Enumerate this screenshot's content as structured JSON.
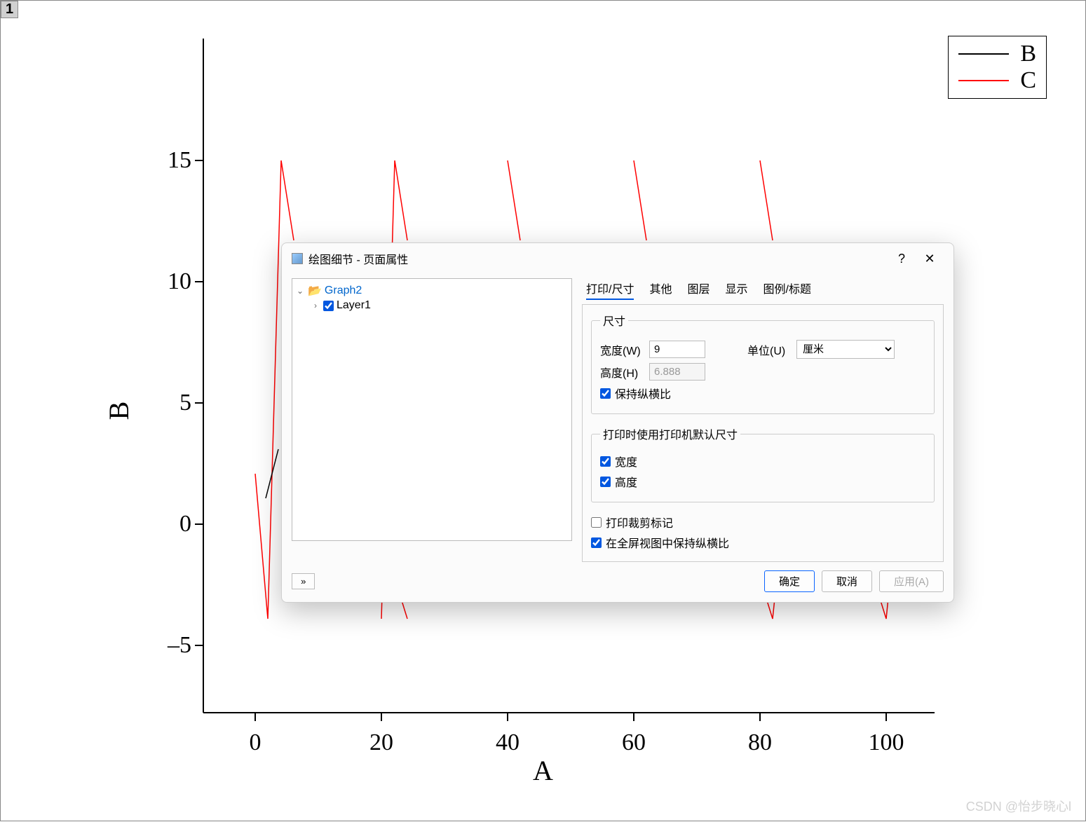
{
  "layer_badge": "1",
  "chart_data": {
    "type": "line",
    "title": "",
    "xlabel": "A",
    "ylabel": "B",
    "x_ticks": [
      0,
      20,
      40,
      60,
      80,
      100
    ],
    "y_ticks": [
      -5,
      0,
      5,
      10,
      15
    ],
    "xlim": [
      -5,
      105
    ],
    "ylim": [
      -8,
      17
    ],
    "legend_position": "top-right",
    "series": [
      {
        "name": "B",
        "color": "#000000",
        "style": "line",
        "values_sample": [
          2,
          4
        ]
      },
      {
        "name": "C",
        "color": "#ff0000",
        "style": "line-sawtooth",
        "period_x": 20,
        "amplitude_high": 15,
        "amplitude_low": -4
      }
    ]
  },
  "legend": {
    "b": "B",
    "c": "C"
  },
  "dialog": {
    "title": "绘图细节 - 页面属性",
    "tree": {
      "graph": "Graph2",
      "layer": "Layer1"
    },
    "tabs": {
      "print_size": "打印/尺寸",
      "other": "其他",
      "layers": "图层",
      "display": "显示",
      "legend_title": "图例/标题"
    },
    "size_group": {
      "legend": "尺寸",
      "width_label": "宽度(W)",
      "width_value": "9",
      "height_label": "高度(H)",
      "height_value": "6.888",
      "unit_label": "单位(U)",
      "unit_value": "厘米",
      "keep_aspect": "保持纵横比"
    },
    "print_defaults": {
      "legend": "打印时使用打印机默认尺寸",
      "width": "宽度",
      "height": "高度"
    },
    "crop_marks": "打印裁剪标记",
    "fullscreen_aspect": "在全屏视图中保持纵横比",
    "buttons": {
      "more": "»",
      "ok": "确定",
      "cancel": "取消",
      "apply": "应用(A)"
    }
  },
  "watermark": "CSDN @怡步晓心l"
}
